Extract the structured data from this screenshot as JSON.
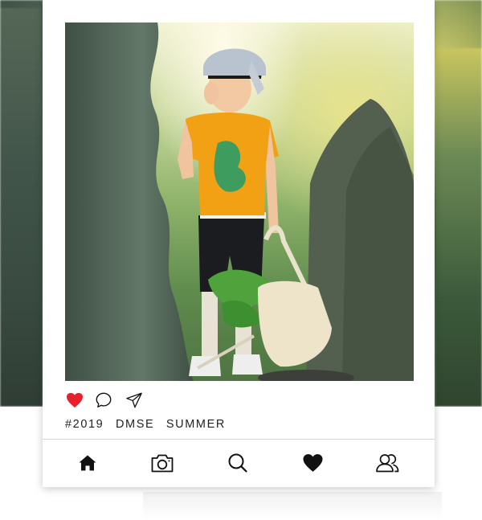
{
  "post": {
    "photo_alt": "Boy in yellow t-shirt and bucket hat holding a white tote bag among stone rocks",
    "liked": true,
    "hashtags": [
      "#2019",
      "DMSE",
      "SUMMER"
    ]
  },
  "actions": {
    "like_icon": "heart-filled-icon",
    "comment_icon": "comment-icon",
    "share_icon": "send-icon"
  },
  "nav": {
    "items": [
      {
        "icon": "home-icon"
      },
      {
        "icon": "camera-icon"
      },
      {
        "icon": "search-icon"
      },
      {
        "icon": "heart-icon"
      },
      {
        "icon": "profile-icon"
      }
    ]
  },
  "colors": {
    "like_red": "#e8202a",
    "icon_dark": "#111111",
    "text": "#222222"
  }
}
